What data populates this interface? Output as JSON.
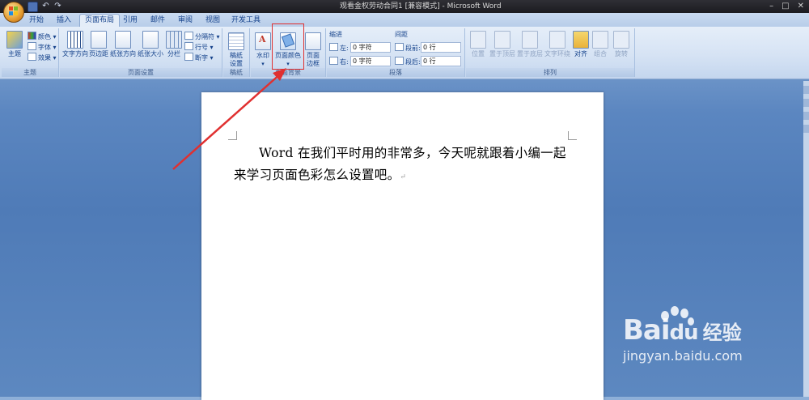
{
  "window": {
    "title": "观看金权劳动合同1 [兼容模式] - Microsoft Word",
    "controls": [
      "–",
      "□",
      "✕"
    ]
  },
  "quick_access": {
    "undo": "↶",
    "redo": "↷"
  },
  "tabs": [
    {
      "label": "开始"
    },
    {
      "label": "插入"
    },
    {
      "label": "页面布局",
      "active": true
    },
    {
      "label": "引用"
    },
    {
      "label": "邮件"
    },
    {
      "label": "审阅"
    },
    {
      "label": "视图"
    },
    {
      "label": "开发工具"
    }
  ],
  "ribbon": {
    "theme": {
      "label": "主题",
      "big_button": "主题",
      "items": [
        "颜色 ▾",
        "字体 ▾",
        "效果 ▾"
      ]
    },
    "page_setup": {
      "label": "页面设置",
      "buttons": [
        "文字方向",
        "页边距",
        "纸张方向",
        "纸张大小",
        "分栏"
      ],
      "items": [
        "分隔符 ▾",
        "行号 ▾",
        "断字 ▾"
      ]
    },
    "manuscript": {
      "label": "稿纸",
      "button_line1": "稿纸",
      "button_line2": "设置"
    },
    "page_background": {
      "label": "页面背景",
      "watermark": "水印",
      "page_color": "页面颜色",
      "page_border_line1": "页面",
      "page_border_line2": "边框"
    },
    "paragraph": {
      "label": "段落",
      "indent_title": "缩进",
      "indent_left_label": "左:",
      "indent_left_value": "0 字符",
      "indent_right_label": "右:",
      "indent_right_value": "0 字符",
      "spacing_title": "间距",
      "spacing_before_label": "段前:",
      "spacing_before_value": "0 行",
      "spacing_after_label": "段后:",
      "spacing_after_value": "0 行"
    },
    "arrange": {
      "label": "排列",
      "buttons": [
        "位置",
        "置于顶层",
        "置于底层",
        "文字环绕",
        "对齐",
        "组合",
        "旋转"
      ]
    }
  },
  "document": {
    "paragraph": "Word 在我们平时用的非常多，今天呢就跟着小编一起来学习页面色彩怎么设置吧。",
    "paragraph_mark": "↵"
  },
  "watermark": {
    "brand_bai": "Bai",
    "brand_du": "du",
    "brand_cn": "经验",
    "url": "jingyan.baidu.com"
  },
  "colors": {
    "highlight_box": "#e03030",
    "arrow": "#e03030",
    "ribbon_text": "#15428b"
  }
}
